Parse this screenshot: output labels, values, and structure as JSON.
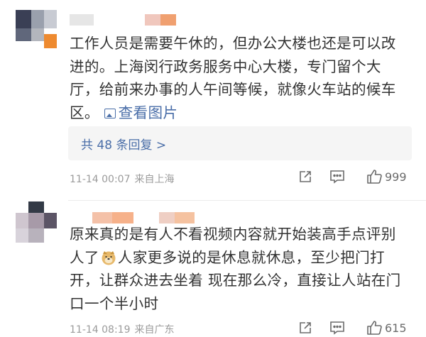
{
  "comments": [
    {
      "text": "工作人员是需要午休的，但办公大楼也还是可以改\n进的。上海闵行政务服务中心大楼，专门留个大\n厅，给前来办事的人午间等候，就像火车站的候车\n区。",
      "view_pictures_label": "查看图片",
      "replies_label": "共 48 条回复 >",
      "time": "11-14 00:07",
      "location": "来自上海",
      "likes": "999",
      "avatar_colors": [
        "#3a3f55",
        "#9aa0ad",
        "#c8cbd3",
        "#60677b",
        "#b3b6bd",
        "#ee8a2f"
      ],
      "name_colors": [
        "#e6e6e6",
        "#f0c7bd",
        "#f0a070"
      ]
    },
    {
      "text_before_emoji": "原来真的是有人不看视频内容就开始装高手点评别\n人了",
      "text_after_emoji": "人家更多说的是休息就休息，至少把门打\n开，让群众进去坐着 现在那么冷，直接让人站在门\n口一个半小时",
      "time": "11-14 08:19",
      "location": "来自广东",
      "likes": "615",
      "avatar_colors": [
        "#333a46",
        "#cfc6cf",
        "#a79aa8",
        "#5c5566",
        "#d8d3db",
        "#b8b2bc"
      ],
      "name_colors": [
        "#f4c1a8",
        "#f6b18a",
        "#efcfc4",
        "#f5c2a0"
      ]
    }
  ],
  "icons": {
    "share": "share-icon",
    "comment": "comment-icon",
    "like": "thumbs-up-icon",
    "emoji": "doge-emoji"
  },
  "colors": {
    "link": "#4a6ea8",
    "text": "#333333",
    "meta": "#9b9b9b",
    "reply_bg": "#f5f5f5"
  }
}
